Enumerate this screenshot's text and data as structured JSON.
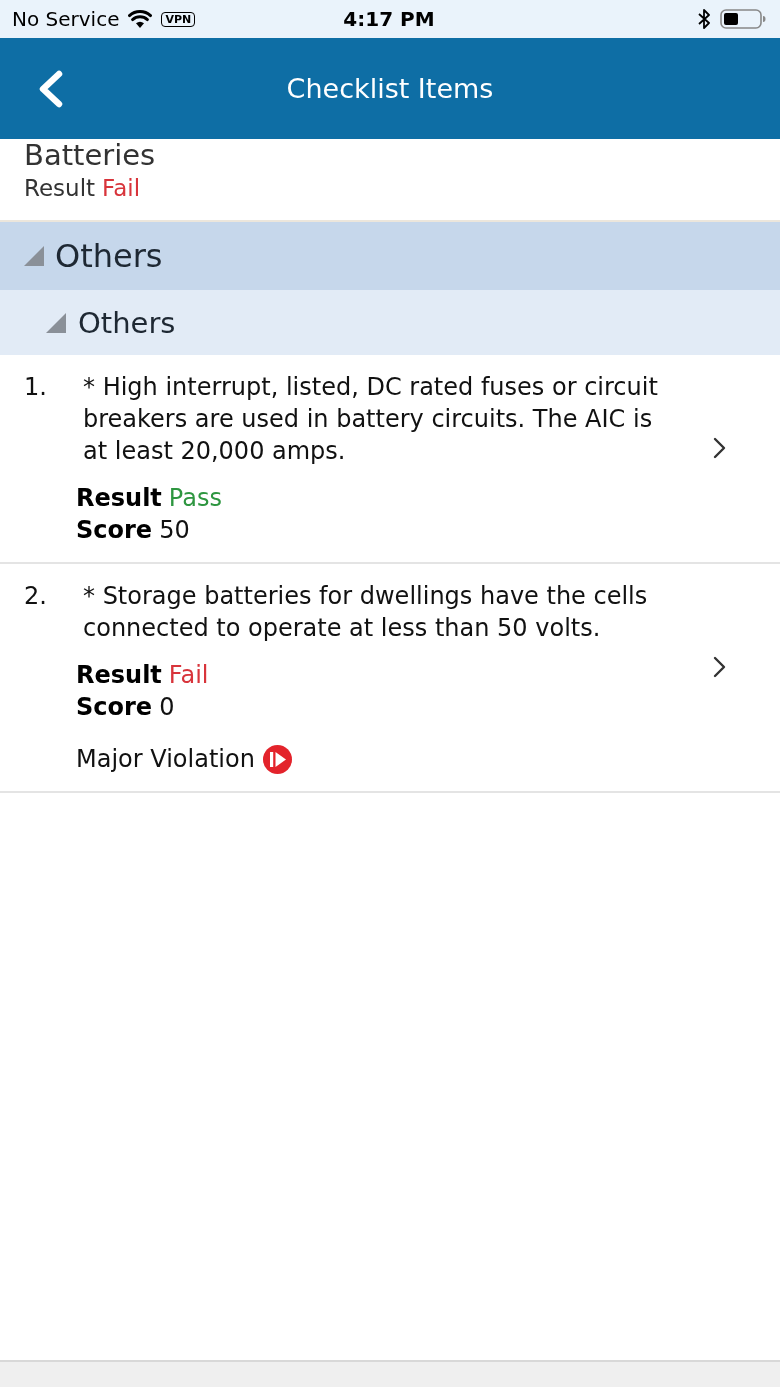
{
  "status_bar": {
    "carrier": "No Service",
    "vpn": "VPN",
    "time": "4:17 PM"
  },
  "nav_bar": {
    "title": "Checklist Items"
  },
  "previous_item": {
    "title": "Batteries",
    "result_label": "Result",
    "result": "Fail",
    "color": "#d8343b"
  },
  "sections": [
    {
      "label": "Others",
      "expanded": true,
      "children": [
        {
          "label": "Others",
          "expanded": true,
          "items": [
            {
              "number": "1.",
              "text": "* High interrupt, listed, DC rated fuses or circuit breakers are used in battery circuits. The AIC is at least 20,000 amps.",
              "result_label": "Result",
              "result": "Pass",
              "color": "#2e9640",
              "score_label": "Score",
              "score": "50"
            },
            {
              "number": "2.",
              "text": "* Storage batteries for dwellings have the cells connected to operate at less than 50 volts.",
              "result_label": "Result",
              "result": "Fail",
              "color": "#d8343b",
              "score_label": "Score",
              "score": "0",
              "violation": "Major Violation"
            }
          ]
        }
      ]
    }
  ]
}
